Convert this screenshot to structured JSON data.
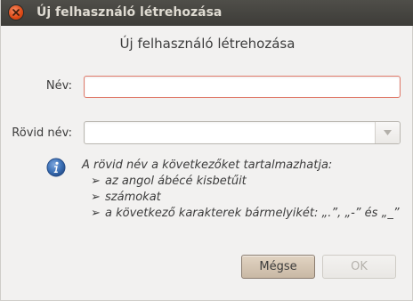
{
  "window": {
    "title": "Új felhasználó létrehozása"
  },
  "dialog": {
    "heading": "Új felhasználó létrehozása",
    "name_label": "Név:",
    "name_value": "",
    "short_name_label": "Rövid név:",
    "short_name_value": "",
    "info_text": "A rövid név a következőket tartalmazhatja:",
    "info_items": [
      "az angol ábécé kisbetűit",
      "számokat",
      "a következő karakterek bármelyikét: „.”, „-” és „_”"
    ],
    "bullet_glyph": "➢",
    "cancel_label": "Mégse",
    "ok_label": "OK"
  },
  "colors": {
    "titlebar": "#3f3e3a",
    "close_button": "#dd4814",
    "invalid_border": "#e07a6a",
    "info_icon": "#3a6fb5"
  },
  "icons": {
    "close": "close-icon",
    "info": "info-icon",
    "dropdown": "chevron-down-icon"
  }
}
